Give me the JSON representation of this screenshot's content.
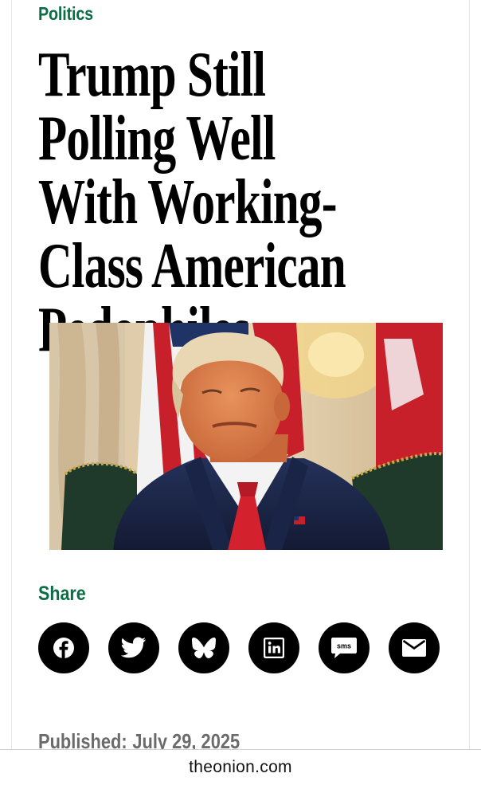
{
  "article": {
    "category": "Politics",
    "headline": "Trump Still Polling Well With Working-Class American Pedophiles",
    "share_label": "Share",
    "published_label": "Published:",
    "published_date": "July 29, 2025"
  },
  "share_buttons": [
    {
      "icon": "facebook-icon"
    },
    {
      "icon": "twitter-icon"
    },
    {
      "icon": "bluesky-icon"
    },
    {
      "icon": "linkedin-icon"
    },
    {
      "icon": "sms-icon",
      "text": "sms"
    },
    {
      "icon": "email-icon"
    }
  ],
  "browser": {
    "url": "theonion.com"
  },
  "colors": {
    "accent_green": "#0a6e45",
    "text_black": "#000000",
    "muted_gray": "#6b6b6b"
  }
}
